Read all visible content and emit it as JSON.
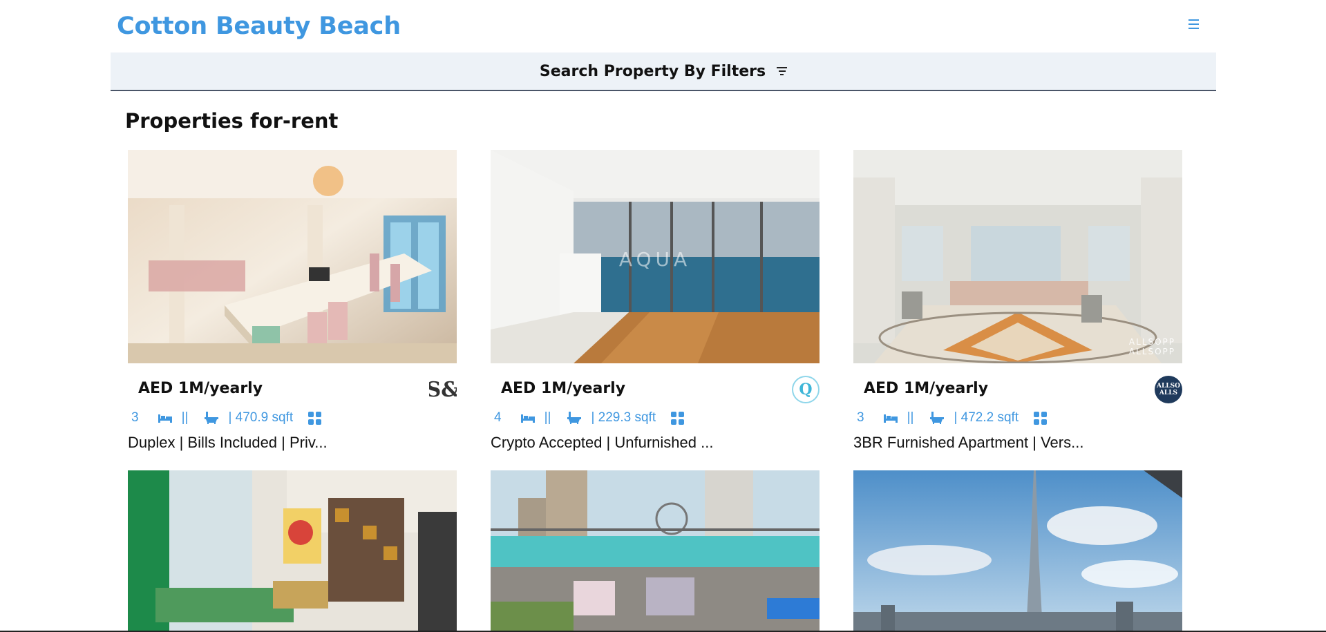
{
  "header": {
    "brand": "Cotton Beauty Beach",
    "menu_icon": "hamburger-menu-icon",
    "accent_color": "#3f97e0"
  },
  "filter_bar": {
    "label": "Search Property By Filters",
    "icon": "filter-icon"
  },
  "section": {
    "title": "Properties for-rent"
  },
  "listings": [
    {
      "price": "AED 1M/yearly",
      "beds": "3",
      "sqft": "| 470.9 sqft",
      "title": "Duplex | Bills Included | Priv...",
      "agency_logo": "S&"
    },
    {
      "price": "AED 1M/yearly",
      "beds": "4",
      "sqft": "| 229.3 sqft",
      "title": "Crypto Accepted | Unfurnished ...",
      "agency_logo": "Q"
    },
    {
      "price": "AED 1M/yearly",
      "beds": "3",
      "sqft": "| 472.2 sqft",
      "title": "3BR Furnished Apartment | Vers...",
      "agency_logo": "ALLSO ALLS"
    }
  ],
  "stat_separator": "||"
}
